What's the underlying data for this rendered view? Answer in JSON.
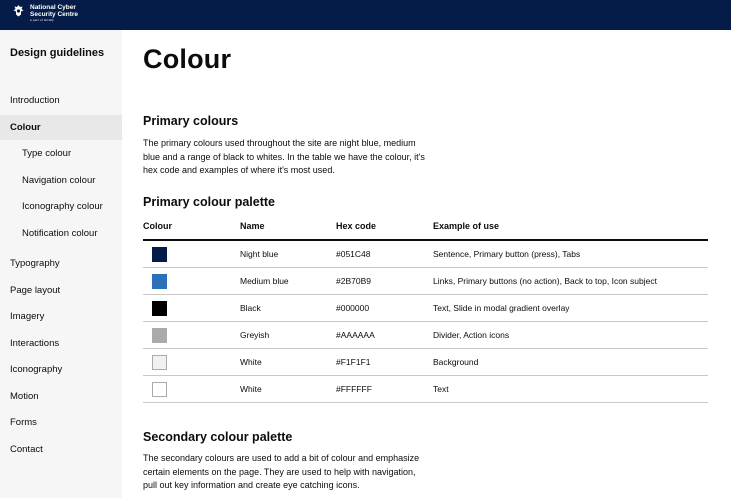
{
  "header": {
    "logo_line1": "National Cyber",
    "logo_line2": "Security Centre",
    "logo_line3": "a part of GCHQ"
  },
  "sidebar": {
    "title": "Design guidelines",
    "items": [
      {
        "label": "Introduction"
      },
      {
        "label": "Colour"
      },
      {
        "label": "Type colour"
      },
      {
        "label": "Navigation colour"
      },
      {
        "label": "Iconography colour"
      },
      {
        "label": "Notification colour"
      },
      {
        "label": "Typography"
      },
      {
        "label": "Page layout"
      },
      {
        "label": "Imagery"
      },
      {
        "label": "Interactions"
      },
      {
        "label": "Iconography"
      },
      {
        "label": "Motion"
      },
      {
        "label": "Forms"
      },
      {
        "label": "Contact"
      }
    ]
  },
  "main": {
    "title": "Colour",
    "primary": {
      "heading": "Primary colours",
      "lines": [
        "The primary colours used throughout the site are night blue, medium",
        "blue and a range of black to whites. In the table we have the colour, it's",
        "hex code and examples of where it's most used."
      ]
    },
    "palette": {
      "heading": "Primary colour palette",
      "columns": [
        "Colour",
        "Name",
        "Hex code",
        "Example of use"
      ],
      "rows": [
        {
          "swatch": "#051C48",
          "name": "Night blue",
          "hex": "#051C48",
          "use": "Sentence, Primary button (press), Tabs"
        },
        {
          "swatch": "#2B70B9",
          "name": "Medium blue",
          "hex": "#2B70B9",
          "use": "Links, Primary buttons (no action), Back to top, Icon subject"
        },
        {
          "swatch": "#000000",
          "name": "Black",
          "hex": "#000000",
          "use": "Text, Slide in modal gradient overlay"
        },
        {
          "swatch": "#AAAAAA",
          "name": "Greyish",
          "hex": "#AAAAAA",
          "use": "Divider, Action icons"
        },
        {
          "swatch": "#F1F1F1",
          "name": "White",
          "hex": "#F1F1F1",
          "use": "Background"
        },
        {
          "swatch": "#FFFFFF",
          "name": "White",
          "hex": "#FFFFFF",
          "use": "Text"
        }
      ]
    },
    "secondary": {
      "heading": "Secondary colour palette",
      "lines": [
        "The secondary colours are used to add a bit of colour and emphasize",
        "certain elements on the page. They are used to help with navigation,",
        "pull out key information and create eye catching icons."
      ]
    }
  },
  "colors": {
    "header_bg": "#051c48",
    "sidebar_bg": "#f6f6f6",
    "active_item_bg": "#e8e8e8"
  }
}
